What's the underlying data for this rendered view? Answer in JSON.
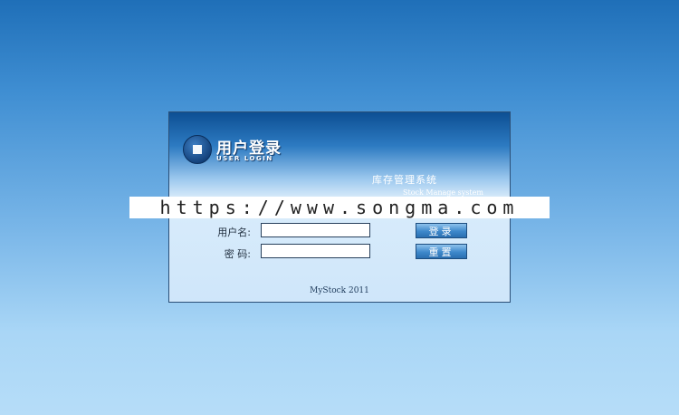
{
  "login": {
    "title_cn": "用户登录",
    "title_en": "USER LOGIN",
    "system_name": "库存管理系统",
    "system_name_en": "Stock Manage system",
    "username_label": "用户名:",
    "password_label": "密  码:",
    "username_value": "",
    "password_value": "",
    "login_button": "登录",
    "reset_button": "重置",
    "footer": "MyStock 2011"
  },
  "watermark": {
    "text": "https://www.songma.com"
  },
  "colors": {
    "background_top": "#1f6fb8",
    "background_bottom": "#b6ddf8",
    "button": "#3e88cb"
  }
}
